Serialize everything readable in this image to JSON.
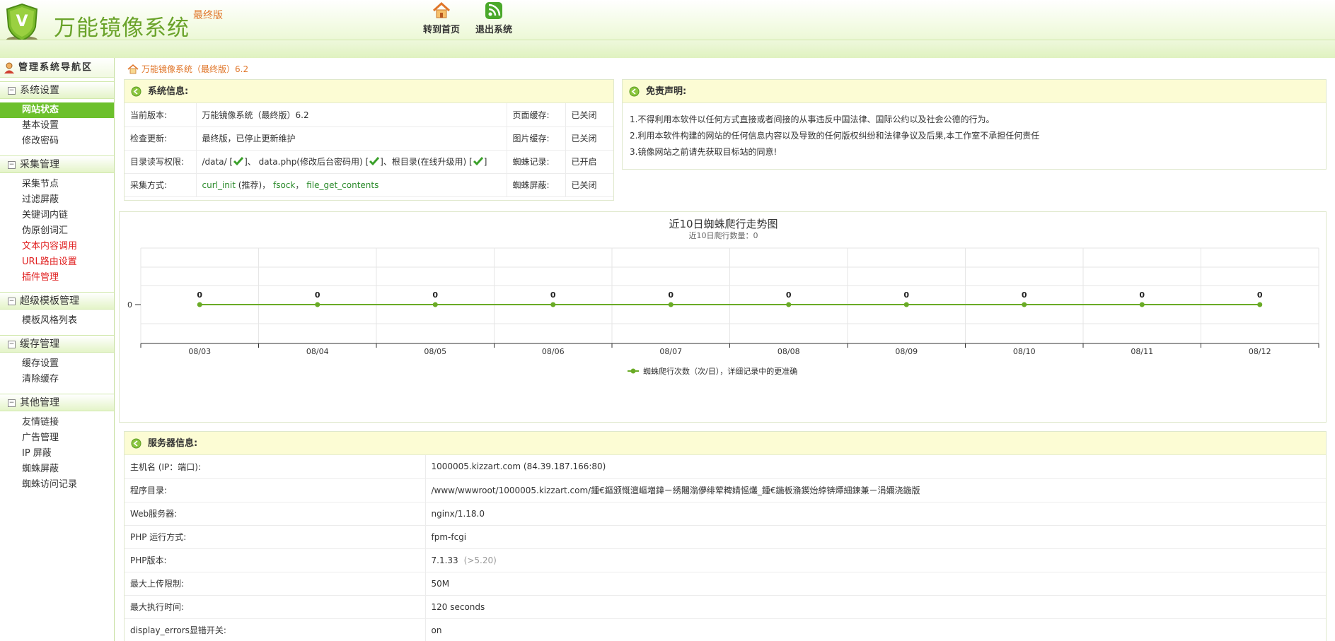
{
  "header": {
    "title": "万能镜像系统",
    "edition": "最终版",
    "logo_letter": "V",
    "nav": [
      {
        "label": "转到首页",
        "icon": "home-icon"
      },
      {
        "label": "退出系统",
        "icon": "rss-exit-icon"
      }
    ]
  },
  "sidebar": {
    "heading": "管理系统导航区",
    "sections": [
      {
        "title": "系统设置",
        "items": [
          {
            "label": "网站状态",
            "active": true
          },
          {
            "label": "基本设置"
          },
          {
            "label": "修改密码"
          }
        ]
      },
      {
        "title": "采集管理",
        "items": [
          {
            "label": "采集节点"
          },
          {
            "label": "过滤屏蔽"
          },
          {
            "label": "关键词内链"
          },
          {
            "label": "伪原创词汇"
          },
          {
            "label": "文本内容调用",
            "red": true
          },
          {
            "label": "URL路由设置",
            "red": true
          },
          {
            "label": "插件管理",
            "red": true
          }
        ]
      },
      {
        "title": "超级模板管理",
        "items": [
          {
            "label": "模板风格列表"
          }
        ]
      },
      {
        "title": "缓存管理",
        "items": [
          {
            "label": "缓存设置"
          },
          {
            "label": "清除缓存"
          }
        ]
      },
      {
        "title": "其他管理",
        "items": [
          {
            "label": "友情链接"
          },
          {
            "label": "广告管理"
          },
          {
            "label": "IP 屏蔽"
          },
          {
            "label": "蜘蛛屏蔽"
          },
          {
            "label": "蜘蛛访问记录"
          }
        ]
      }
    ]
  },
  "breadcrumb": "万能镜像系统（最终版）6.2",
  "sysinfo": {
    "title": "系统信息:",
    "rows": [
      {
        "k": "当前版本:",
        "v": "万能镜像系统（最终版）6.2",
        "k2": "页面缓存:",
        "v2": "已关闭"
      },
      {
        "k": "检查更新:",
        "v": "最终版，已停止更新维护",
        "k2": "图片缓存:",
        "v2": "已关闭"
      },
      {
        "k": "目录读写权限:",
        "v_a": "/data/ [",
        "v_b": "]、 data.php(修改后台密码用) [",
        "v_c": "]、根目录(在线升级用) [",
        "v_d": "]",
        "k2": "蜘蛛记录:",
        "v2": "已开启"
      },
      {
        "k": "采集方式:",
        "m1": "curl_init",
        "m1b": " (推荐)，",
        "m2": "fsock",
        "m2b": "，",
        "m3": "file_get_contents",
        "k2": "蜘蛛屏蔽:",
        "v2": "已关闭"
      }
    ]
  },
  "disclaimer": {
    "title": "免责声明:",
    "lines": [
      "1.不得利用本软件以任何方式直接或者间接的从事违反中国法律、国际公约以及社会公德的行为。",
      "2.利用本软件构建的网站的任何信息内容以及导致的任何版权纠纷和法律争议及后果,本工作室不承担任何责任",
      "3.镜像网站之前请先获取目标站的同意!"
    ]
  },
  "chart_data": {
    "type": "line",
    "title": "近10日蜘蛛爬行走势图",
    "subtitle": "近10日爬行数量：0",
    "categories": [
      "08/03",
      "08/04",
      "08/05",
      "08/06",
      "08/07",
      "08/08",
      "08/09",
      "08/10",
      "08/11",
      "08/12"
    ],
    "series": [
      {
        "name": "蜘蛛爬行次数（次/日），详细记录中的更准确",
        "values": [
          0,
          0,
          0,
          0,
          0,
          0,
          0,
          0,
          0,
          0
        ],
        "color": "#6aab26"
      }
    ],
    "yticks": [
      "0"
    ],
    "grid": true,
    "legend": "bottom"
  },
  "server": {
    "title": "服务器信息:",
    "rows": [
      {
        "k": "主机名 (IP：端口):",
        "v": "1000005.kizzart.com  (84.39.187.166:80)"
      },
      {
        "k": "程序目录:",
        "v": "/www/wwwroot/1000005.kizzart.com/鍾€鏂颁慨澶嶇増鍏ㄧ綉闀滃儚绯荤粺婧愮爜_鍾€鍦板潃鍥炲綍锛燂細鍊兼ㄧ涓嬭浇鍦版"
      },
      {
        "k": "Web服务器:",
        "v": "nginx/1.18.0"
      },
      {
        "k": "PHP 运行方式:",
        "v": "fpm-fcgi"
      },
      {
        "k": "PHP版本:",
        "v": "7.1.33",
        "note": "(>5.20)"
      },
      {
        "k": "最大上传限制:",
        "v": "50M"
      },
      {
        "k": "最大执行时间:",
        "v": "120 seconds"
      },
      {
        "k": "display_errors显错开关:",
        "v": "on"
      }
    ]
  },
  "colors": {
    "accent": "#6cc02c",
    "panel_header": "#fcfcd4",
    "red": "#e02020",
    "green": "#2a8a2a"
  }
}
